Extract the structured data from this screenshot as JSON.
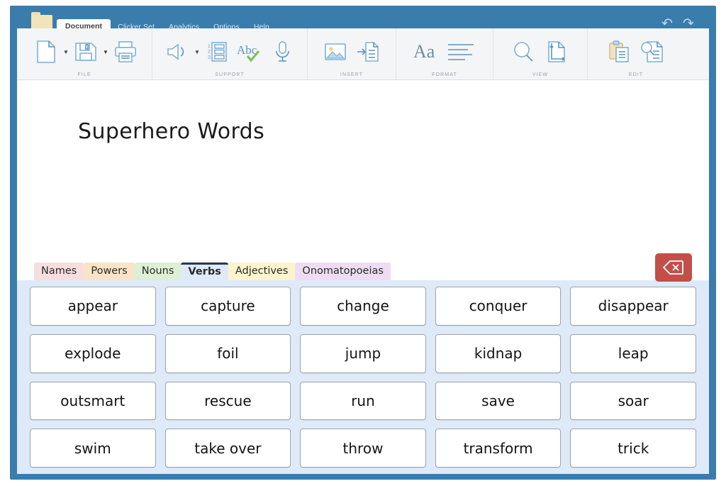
{
  "window": {
    "folder_icon": "folder-icon",
    "menu_tabs": [
      {
        "label": "Document",
        "active": true
      },
      {
        "label": "Clicker Set",
        "active": false
      },
      {
        "label": "Analytics",
        "active": false
      },
      {
        "label": "Options",
        "active": false
      },
      {
        "label": "Help",
        "active": false
      }
    ],
    "undo_label": "↶",
    "redo_label": "↷",
    "frame_color": "#3a7cab"
  },
  "ribbon": {
    "groups": [
      {
        "label": "FILE",
        "items": [
          {
            "icon": "new-document-icon",
            "caret": true
          },
          {
            "icon": "save-icon",
            "caret": true
          },
          {
            "icon": "print-icon",
            "caret": false
          }
        ]
      },
      {
        "label": "SUPPORT",
        "items": [
          {
            "icon": "speaker-icon",
            "caret": true
          },
          {
            "icon": "word-list-icon",
            "caret": false
          },
          {
            "icon": "spell-check-icon",
            "caret": false
          },
          {
            "icon": "microphone-icon",
            "caret": false
          }
        ]
      },
      {
        "label": "INSERT",
        "items": [
          {
            "icon": "picture-icon",
            "caret": false
          },
          {
            "icon": "insert-page-icon",
            "caret": false
          }
        ]
      },
      {
        "label": "FORMAT",
        "items": [
          {
            "icon": "font-icon",
            "caret": false
          },
          {
            "icon": "align-icon",
            "caret": false
          }
        ]
      },
      {
        "label": "VIEW",
        "items": [
          {
            "icon": "zoom-icon",
            "caret": false
          },
          {
            "icon": "page-size-icon",
            "caret": false
          }
        ]
      },
      {
        "label": "EDIT",
        "items": [
          {
            "icon": "paste-icon",
            "caret": false
          },
          {
            "icon": "find-in-document-icon",
            "caret": false
          }
        ]
      }
    ]
  },
  "document": {
    "title": "Superhero Words"
  },
  "word_bank": {
    "delete_button_icon": "backspace-delete-icon",
    "categories": [
      {
        "label": "Names",
        "color": "#f6dede",
        "active": false
      },
      {
        "label": "Powers",
        "color": "#f9e4c8",
        "active": false
      },
      {
        "label": "Nouns",
        "color": "#ddefd5",
        "active": false
      },
      {
        "label": "Verbs",
        "color": "#dfeaf8",
        "active": true
      },
      {
        "label": "Adjectives",
        "color": "#fbf4cd",
        "active": false
      },
      {
        "label": "Onomatopoeias",
        "color": "#eedcf2",
        "active": false
      }
    ],
    "words": [
      "appear",
      "capture",
      "change",
      "conquer",
      "disappear",
      "explode",
      "foil",
      "jump",
      "kidnap",
      "leap",
      "outsmart",
      "rescue",
      "run",
      "save",
      "soar",
      "swim",
      "take over",
      "throw",
      "transform",
      "trick"
    ]
  }
}
